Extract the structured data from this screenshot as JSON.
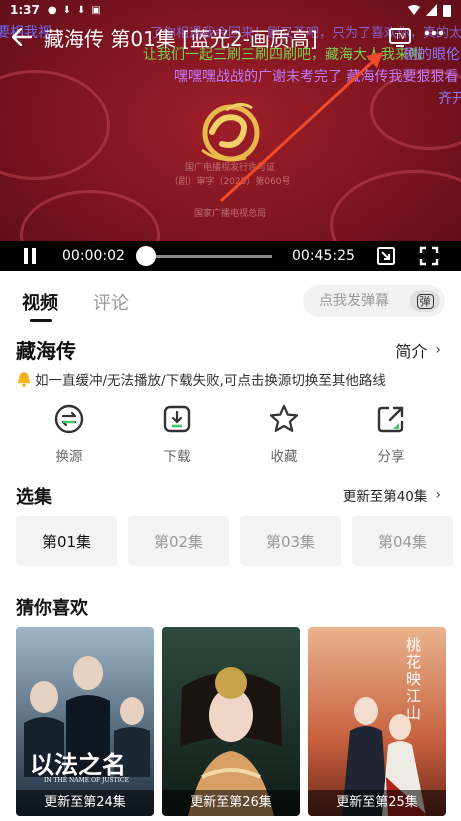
{
  "status_bar": {
    "time": "1:37"
  },
  "player": {
    "title": "藏海传 第01集 [蓝光2-画质高]",
    "current_time": "00:00:02",
    "duration": "00:45:25",
    "progress_fraction": 0.0007,
    "danmaku": [
      {
        "text": "要相我视",
        "color": "#6b6bff"
      },
      {
        "text": "了你相遇我会回来！剧又开吧，只为了喜欢你，真的太赞了，期待新剧！",
        "color": "#8a7bff"
      },
      {
        "text": "让我们一起三刷三刷四刷吧，藏海大人我来啦",
        "color": "#7ad14a"
      },
      {
        "text": "剧的眼伦",
        "color": "#8a7bff"
      },
      {
        "text": "嘿嘿嘿战战的广谢末考完了 藏海传我要狠狠看",
        "color": "#c07bff"
      },
      {
        "text": "齐开",
        "color": "#8a7bff"
      }
    ],
    "certificate_lines": [
      "国广电播视发行许可证",
      "（剧）审字（2025）第060号",
      "国家广播电视总局"
    ]
  },
  "tabs": [
    {
      "label": "视频"
    },
    {
      "label": "评论"
    }
  ],
  "danmu_input": {
    "placeholder": "点我发弹幕",
    "send_label": "弹"
  },
  "show": {
    "title": "藏海传",
    "intro_label": "简介",
    "notice": "如一直缓冲/无法播放/下载失败,可点击换源切换至其他路线"
  },
  "actions": [
    {
      "label": "换源",
      "icon": "swap-icon"
    },
    {
      "label": "下载",
      "icon": "download-icon"
    },
    {
      "label": "收藏",
      "icon": "star-icon"
    },
    {
      "label": "分享",
      "icon": "share-icon"
    }
  ],
  "episodes": {
    "title": "选集",
    "update_label": "更新至第40集",
    "items": [
      "第01集",
      "第02集",
      "第03集",
      "第04集"
    ]
  },
  "recommendations": {
    "title": "猜你喜欢",
    "items": [
      {
        "caption": "更新至第24集",
        "poster_text": "以法之名",
        "poster_sub": "IN THE NAME OF JUSTICE"
      },
      {
        "caption": "更新至第26集",
        "poster_text": "",
        "poster_sub": ""
      },
      {
        "caption": "更新至第25集",
        "poster_text": "桃花映江山",
        "poster_sub": ""
      }
    ]
  }
}
